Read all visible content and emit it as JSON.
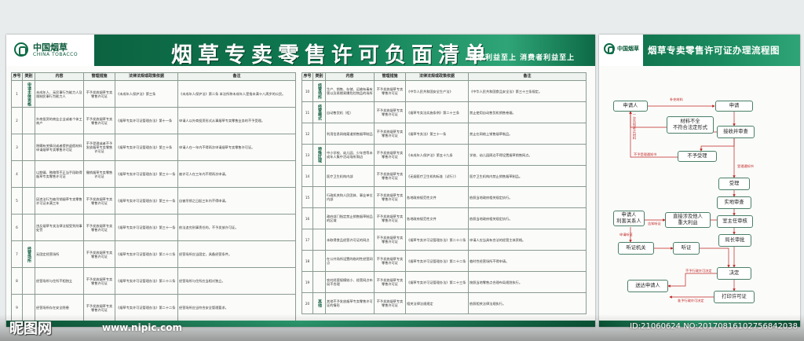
{
  "left_board": {
    "logo_cn": "中国烟草",
    "logo_en": "CHINA TOBACCO",
    "title": "烟草专卖零售许可负面清单",
    "slogan": "国家利益至上  消费者利益至上",
    "headers": [
      "序号",
      "类别",
      "内容",
      "管理措施",
      "法律法规或政策依据",
      "备注"
    ],
    "headers_right": [
      "序号",
      "类别",
      "内容",
      "管理措施",
      "法律法规或政策依据",
      "备注"
    ],
    "rows_left": [
      {
        "no": "1",
        "cat": "申请主体资格",
        "content": "未成年人、无民事行为能力人及限制民事行为能力人",
        "measure": "不予发放烟草专卖零售许可证",
        "basis": "《未成年人保护法》第三条",
        "note": "《未成年人保护法》第二条 本法所称未成年人是指未满十八周岁的公民。"
      },
      {
        "no": "2",
        "cat": "",
        "content": "外商投资的商业企业或者个体工商户",
        "measure": "不予发放烟草专卖零售许可证",
        "basis": "《烟草专卖许可证管理办法》第十一条",
        "note": "申请人以外商投资形式从事烟草专卖零售业务的不予受理。"
      },
      {
        "no": "3",
        "cat": "",
        "content": "隐瞒有关情况或者提供虚假材料申请烟草专卖零售许可证",
        "measure": "不予受理或者不予发放烟草专卖零售许可证",
        "basis": "《烟草专卖许可证管理办法》第三十条",
        "note": "申请人在一年内不得再次申请烟草专卖零售许可证。"
      },
      {
        "no": "4",
        "cat": "",
        "content": "以欺骗、贿赂等不正当手段取得烟草专卖零售许可证",
        "measure": "撤销烟草专卖零售许可证",
        "basis": "《烟草专卖许可证管理办法》第三十一条",
        "note": "被许可人在三年内不得再次申请。"
      },
      {
        "no": "5",
        "cat": "",
        "content": "因违法行为被吊销烟草专卖零售许可证未满三年",
        "measure": "不予发放烟草专卖零售许可证",
        "basis": "《烟草专卖许可证管理办法》第三十一条",
        "note": "自被吊销之日起三年内不得申请。"
      },
      {
        "no": "6",
        "cat": "",
        "content": "违反烟草专卖法律法规受到刑事处罚",
        "measure": "不予发放烟草专卖零售许可证",
        "basis": "《烟草专卖许可证管理办法》第三十一条",
        "note": "依法追究刑事责任的，不予发放许可证。"
      },
      {
        "no": "7",
        "cat": "经营场所",
        "content": "无固定经营场所",
        "measure": "不予发放烟草专卖零售许可证",
        "basis": "《烟草专卖许可证管理办法》第二十二条",
        "note": "经营场所应当固定，具备经营条件。"
      },
      {
        "no": "8",
        "cat": "",
        "content": "经营场所与住所不相独立",
        "measure": "不予发放烟草专卖零售许可证",
        "basis": "《烟草专卖许可证管理办法》第二十二条",
        "note": "经营场所与住所应当相对独立。"
      },
      {
        "no": "9",
        "cat": "",
        "content": "经营场所存在安全隐患",
        "measure": "不予发放烟草专卖零售许可证",
        "basis": "《烟草专卖许可证管理办法》第二十二条",
        "note": "经营场所应当符合安全管理要求。"
      }
    ],
    "rows_right": [
      {
        "no": "10",
        "cat": "经营场所",
        "content": "生产、销售、存储、运输有毒有害以及易燃易爆危险物品的场所",
        "measure": "不予发放烟草专卖零售许可证",
        "basis": "《中华人民共和国安全生产法》",
        "note": "《中华人民共和国食品安全法》第三十三条规定。"
      },
      {
        "no": "11",
        "cat": "经营模式",
        "content": "自动售货机（柜）",
        "measure": "不予发放烟草专卖零售许可证",
        "basis": "《烟草专卖法实施条例》第二十三条",
        "note": "禁止使用自动售货机销售卷烟。"
      },
      {
        "no": "12",
        "cat": "",
        "content": "利用信息网络渠道销售烟草制品",
        "measure": "不予发放烟草专卖零售许可证",
        "basis": "《烟草专卖法》第三十一条",
        "note": "禁止在网络上销售烟草制品。"
      },
      {
        "no": "13",
        "cat": "特殊区域",
        "content": "中小学校、幼儿园、少年宫等未成年人集中活动场所周边",
        "measure": "不予发放烟草专卖零售许可证",
        "basis": "《未成年人保护法》第五十九条",
        "note": "学校、幼儿园周边不得设置烟草销售网点。"
      },
      {
        "no": "14",
        "cat": "",
        "content": "医疗卫生机构内部",
        "measure": "不予发放烟草专卖零售许可证",
        "basis": "《无烟医疗卫生机构标准（试行）》",
        "note": "医疗卫生机构内禁止销售烟草制品。"
      },
      {
        "no": "15",
        "cat": "",
        "content": "行政机关和人民团体、事业单位内部",
        "measure": "不予发放烟草专卖零售许可证",
        "basis": "各地政府规范性文件",
        "note": "依照当地政府相关规定执行。"
      },
      {
        "no": "16",
        "cat": "",
        "content": "政府部门指定禁止销售烟草制品的区域",
        "measure": "不予发放烟草专卖零售许可证",
        "basis": "各地政府规范性文件",
        "note": "依照当地政府相关规定执行。"
      },
      {
        "no": "17",
        "cat": "",
        "content": "未取得食品经营许可证的网点",
        "measure": "不予发放烟草专卖零售许可证",
        "basis": "《烟草专卖许可证管理办法》第二十二条",
        "note": "申请人应当具有合法的经营主体资格。"
      },
      {
        "no": "18",
        "cat": "",
        "content": "在公共场所设置的临时性经营网点",
        "measure": "不予发放烟草专卖零售许可证",
        "basis": "《烟草专卖许可证管理办法》第二十二条",
        "note": "临时性经营场所不得申请。"
      },
      {
        "no": "19",
        "cat": "",
        "content": "农村经营规模较小、经营网点布局不合理",
        "measure": "不予发放烟草专卖零售许可证",
        "basis": "《烟草专卖许可证管理办法》第二十三条",
        "note": "按照当地零售点合理布局规划执行。"
      },
      {
        "no": "20",
        "cat": "其他",
        "content": "其他不予发放烟草专卖零售许可证的情形",
        "measure": "不予发放烟草专卖零售许可证",
        "basis": "相关法律法规规定",
        "note": "依照相关法律法规执行。"
      }
    ]
  },
  "right_board": {
    "logo_cn": "中国烟草",
    "title": "烟草专卖零售许可证办理流程图",
    "flow": {
      "applicant": "申请人",
      "apply": "申请",
      "materials_incomplete": "材料不全\n不符合法定形式",
      "accept_review": "接收并审查",
      "not_accept": "不予受理",
      "accept": "受理",
      "applicant_interest": "申请人\n利害关系人",
      "site_review": "实地审查",
      "direct_interest": "直接涉及他人\n重大利益",
      "internal_review": "室主任审核",
      "chief_approve": "局长审批",
      "hearing_org": "听证机关",
      "hearing": "听证",
      "decide": "决定",
      "deliver": "送达申请人",
      "print": "打印许可证"
    },
    "notes": {
      "n1": "补充材料",
      "n2": "一次告知补正材料",
      "n3": "不予受理通知书",
      "n4": "受理通知书",
      "n5": "告知听证",
      "n6": "申请听证",
      "n7": "不予行政许可决定",
      "n8": "准予行政许可决定"
    }
  },
  "watermark": {
    "brand": "昵图网",
    "url": "www.nipic.com",
    "id": "ID:21060624 NO:20170816102756842038"
  }
}
